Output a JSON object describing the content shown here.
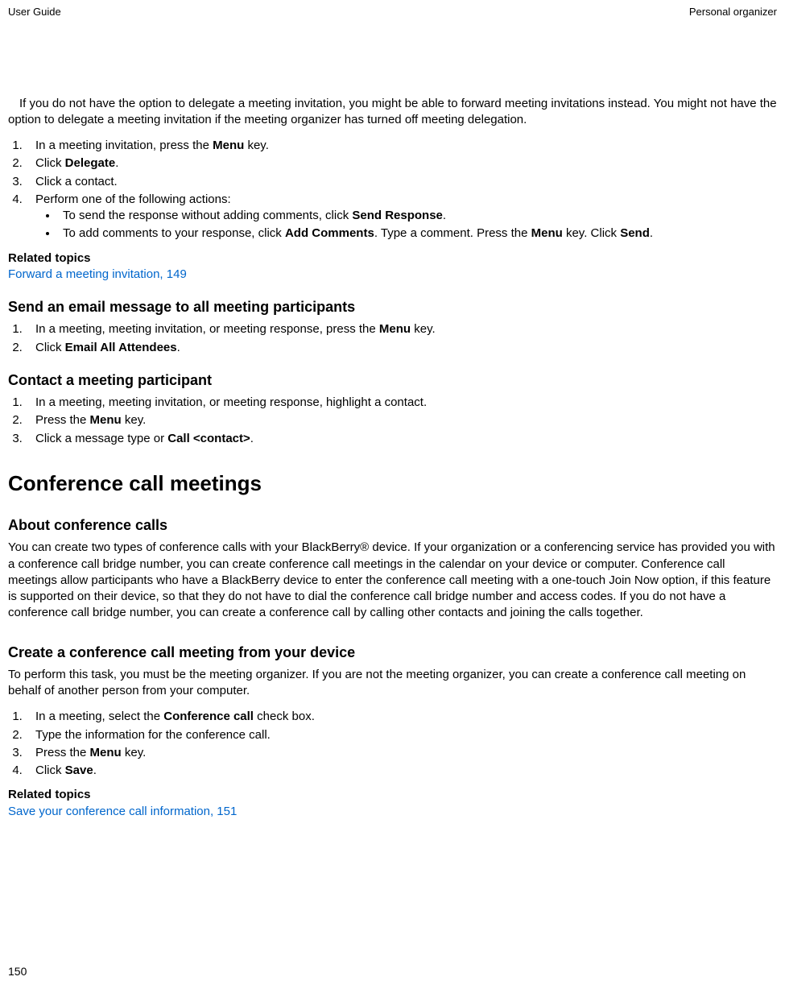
{
  "header": {
    "left": "User Guide",
    "right": "Personal organizer"
  },
  "intro": {
    "text": "If you do not have the option to delegate a meeting invitation, you might be able to forward meeting invitations instead. You might not have the option to delegate a meeting invitation if the meeting organizer has turned off meeting delegation."
  },
  "steps1": {
    "item1_pre": "In a meeting invitation, press the ",
    "item1_bold": "Menu",
    "item1_post": " key.",
    "item2_pre": "Click ",
    "item2_bold": "Delegate",
    "item2_post": ".",
    "item3": "Click a contact.",
    "item4": "Perform one of the following actions:",
    "bullet1_pre": "To send the response without adding comments, click ",
    "bullet1_bold": "Send Response",
    "bullet1_post": ".",
    "bullet2_pre": "To add comments to your response, click ",
    "bullet2_bold1": "Add Comments",
    "bullet2_mid1": ". Type a comment. Press the ",
    "bullet2_bold2": "Menu",
    "bullet2_mid2": " key. Click ",
    "bullet2_bold3": "Send",
    "bullet2_post": "."
  },
  "related1": {
    "label": "Related topics",
    "link": "Forward a meeting invitation, 149"
  },
  "section_email": {
    "title": "Send an email message to all meeting participants",
    "item1_pre": "In a meeting, meeting invitation, or meeting response, press the ",
    "item1_bold": "Menu",
    "item1_post": " key.",
    "item2_pre": "Click ",
    "item2_bold": "Email All Attendees",
    "item2_post": "."
  },
  "section_contact": {
    "title": "Contact a meeting participant",
    "item1": "In a meeting, meeting invitation, or meeting response, highlight a contact.",
    "item2_pre": "Press the ",
    "item2_bold": "Menu",
    "item2_post": " key.",
    "item3_pre": "Click a message type or ",
    "item3_bold": "Call <contact>",
    "item3_post": "."
  },
  "section_conf": {
    "title": "Conference call meetings",
    "about_title": "About conference calls",
    "about_text": "You can create two types of conference calls with your BlackBerry® device. If your organization or a conferencing service has provided you with a conference call bridge number, you can create conference call meetings in the calendar on your device or computer. Conference call meetings allow participants who have a BlackBerry device to enter the conference call meeting with a one-touch Join Now option, if this feature is supported on their device, so that they do not have to dial the conference call bridge number and access codes. If you do not have a conference call bridge number, you can create a conference call by calling other contacts and joining the calls together.",
    "create_title": "Create a conference call meeting from your device",
    "create_intro": "To perform this task, you must be the meeting organizer. If you are not the meeting organizer, you can create a conference call meeting on behalf of another person from your computer.",
    "item1_pre": "In a meeting, select the ",
    "item1_bold": "Conference call",
    "item1_post": " check box.",
    "item2": "Type the information for the conference call.",
    "item3_pre": "Press the ",
    "item3_bold": "Menu",
    "item3_post": " key.",
    "item4_pre": "Click ",
    "item4_bold": "Save",
    "item4_post": "."
  },
  "related2": {
    "label": "Related topics",
    "link": "Save your conference call information, 151"
  },
  "page_number": "150"
}
